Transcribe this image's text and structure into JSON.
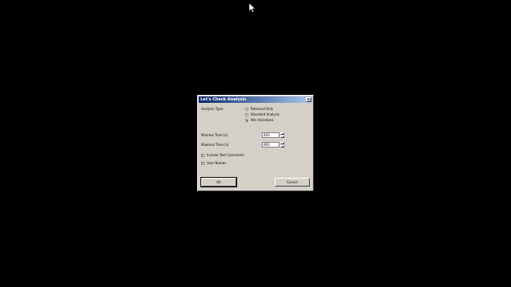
{
  "dialog": {
    "title": "Let's Check Analysis",
    "close_label": "x",
    "analysis_type_label": "Analysis Type:",
    "radio_options": [
      "Retrieval Only",
      "Standard Analysis",
      "Win Variations"
    ],
    "selected_option": "Win Variations",
    "minimal_time_label": "Minimal Time [s]",
    "minimal_time_value": "400",
    "maximal_time_label": "Maximal Time [s]",
    "maximal_time_value": "900",
    "include_text_comments_label": "Include Text Comments",
    "include_text_comments_checked": true,
    "user_names_label": "User Names",
    "user_names_checked": true,
    "ok_label": "Ok",
    "cancel_label": "Cancel"
  },
  "icons": {
    "cursor": "arrow-cursor-icon",
    "close": "close-icon"
  },
  "colors": {
    "desktop": "#000000",
    "dialog_face": "#d4d0c8",
    "titlebar_start": "#0a246a",
    "titlebar_end": "#a6caf0"
  }
}
